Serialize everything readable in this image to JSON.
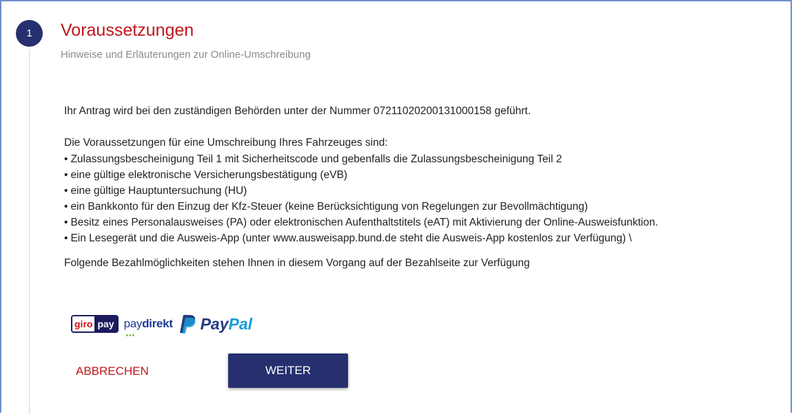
{
  "step": {
    "number": "1",
    "title": "Voraussetzungen",
    "subtitle": "Hinweise und Erläuterungen zur Online-Umschreibung"
  },
  "content": {
    "application_text": "Ihr Antrag wird bei den zuständigen Behörden unter der Nummer 07211020200131000158 geführt.",
    "requirements_intro": "Die Voraussetzungen für eine Umschreibung Ihres Fahrzeuges sind:",
    "requirements": [
      "Zulassungsbescheinigung Teil 1 mit Sicherheitscode und gebenfalls die Zulassungsbescheinigung Teil 2",
      "eine gültige elektronische Versicherungsbestätigung (eVB)",
      "eine gültige Hauptuntersuchung (HU)",
      "ein Bankkonto für den Einzug der Kfz-Steuer (keine Berücksichtigung von Regelungen zur Bevollmächtigung)",
      "Besitz eines Personalausweises (PA) oder elektronischen Aufenthaltstitels (eAT) mit Aktivierung der Online-Ausweisfunktion.",
      "Ein Lesegerät und die Ausweis-App (unter www.ausweisapp.bund.de steht die Ausweis-App kostenlos zur Verfügung) \\"
    ],
    "payment_text": "Folgende Bezahlmöglichkeiten stehen Ihnen in diesem Vorgang auf der Bezahlseite zur Verfügung"
  },
  "payment_logos": {
    "giropay": {
      "giro": "giro",
      "pay": "pay"
    },
    "paydirekt": {
      "pay": "pay",
      "direkt": "direkt"
    },
    "paypal": {
      "pay": "Pay",
      "pal": "Pal"
    }
  },
  "actions": {
    "cancel_label": "ABBRECHEN",
    "next_label": "WEITER"
  },
  "colors": {
    "accent_red": "#c0161c",
    "primary_navy": "#27306e",
    "frame_blue": "#6f8ccf"
  }
}
